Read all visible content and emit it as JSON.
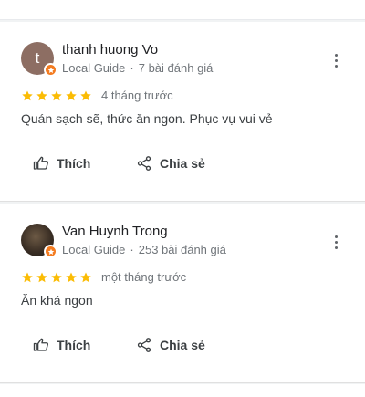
{
  "reviews": [
    {
      "avatar_letter": "t",
      "author": "thanh huong Vo",
      "badge": "Local Guide",
      "review_count": "7 bài đánh giá",
      "time": "4 tháng trước",
      "rating": 5,
      "text": "Quán sạch sẽ, thức ăn ngon. Phục vụ vui vẻ",
      "like_label": "Thích",
      "share_label": "Chia sẻ"
    },
    {
      "avatar_letter": "",
      "author": "Van Huynh Trong",
      "badge": "Local Guide",
      "review_count": "253 bài đánh giá",
      "time": "một tháng trước",
      "rating": 5,
      "text": "Ăn khá ngon",
      "like_label": "Thích",
      "share_label": "Chia sẻ"
    }
  ],
  "colors": {
    "star": "#fbbc04",
    "badge": "#f37b20",
    "secondary_text": "#70757a"
  },
  "icons": {
    "star": "star-icon",
    "like": "thumbs-up-icon",
    "share": "share-icon",
    "more": "more-vertical-icon",
    "badge": "local-guide-badge-icon"
  }
}
